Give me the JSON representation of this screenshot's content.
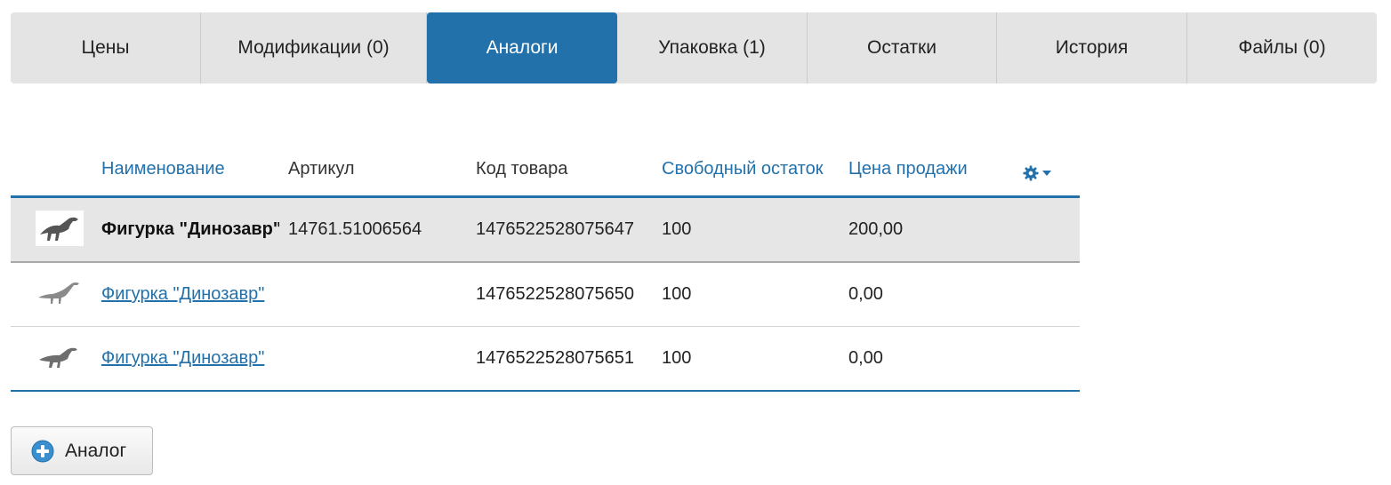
{
  "tabs": [
    {
      "label": "Цены",
      "active": false
    },
    {
      "label": "Модификации (0)",
      "active": false
    },
    {
      "label": "Аналоги",
      "active": true
    },
    {
      "label": "Упаковка (1)",
      "active": false
    },
    {
      "label": "Остатки",
      "active": false
    },
    {
      "label": "История",
      "active": false
    },
    {
      "label": "Файлы (0)",
      "active": false
    }
  ],
  "table": {
    "columns": {
      "name": "Наименование",
      "article": "Артикул",
      "code": "Код товара",
      "free_stock": "Свободный остаток",
      "sale_price": "Цена продажи"
    },
    "rows": [
      {
        "name": "Фигурка \"Динозавр\"",
        "article": "14761.51006564",
        "code": "1476522528075647",
        "free_stock": "100",
        "sale_price": "200,00",
        "icon": "dinosaur-icon"
      },
      {
        "name": "Фигурка \"Динозавр\"",
        "article": "",
        "code": "1476522528075650",
        "free_stock": "100",
        "sale_price": "0,00",
        "icon": "dinosaur-icon"
      },
      {
        "name": "Фигурка \"Динозавр\"",
        "article": "",
        "code": "1476522528075651",
        "free_stock": "100",
        "sale_price": "0,00",
        "icon": "dinosaur-icon"
      }
    ]
  },
  "actions": {
    "add_analog_label": "Аналог"
  },
  "colors": {
    "accent": "#2271ab",
    "tab_bg": "#e4e4e4",
    "selected_row": "#e6e6e6"
  }
}
